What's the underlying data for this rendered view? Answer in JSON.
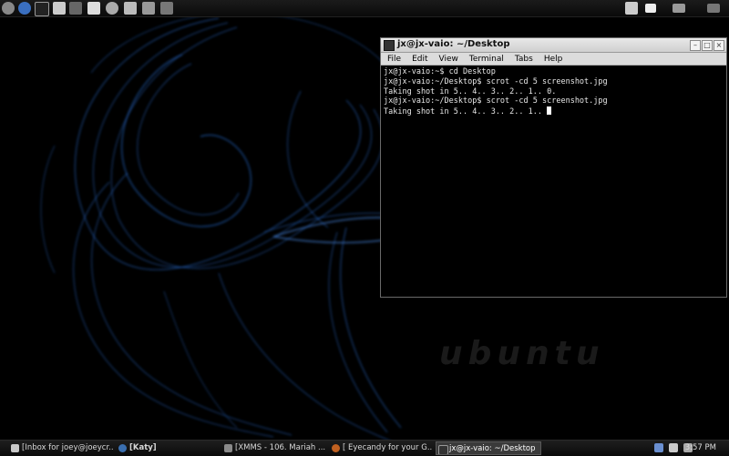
{
  "wallpaper": {
    "brand_text": "ubuntu"
  },
  "top_panel": {
    "icons": [
      "app-menu-icon",
      "globe-icon",
      "terminal-icon",
      "kmail-icon",
      "media-icon",
      "bird-icon",
      "disc-icon",
      "palette-icon",
      "mixer-icon",
      "bluetooth-star-icon"
    ],
    "right_icons": [
      "trash-icon",
      "window-icon",
      "window-icon-2",
      "desktop-icon"
    ]
  },
  "terminal": {
    "title": "jx@jx-vaio: ~/Desktop",
    "menu": [
      "File",
      "Edit",
      "View",
      "Terminal",
      "Tabs",
      "Help"
    ],
    "lines": [
      "jx@jx-vaio:~$ cd Desktop",
      "jx@jx-vaio:~/Desktop$ scrot -cd 5 screenshot.jpg",
      "Taking shot in 5.. 4.. 3.. 2.. 1.. 0.",
      "jx@jx-vaio:~/Desktop$ scrot -cd 5 screenshot.jpg",
      "Taking shot in 5.. 4.. 3.. 2.. 1.. "
    ]
  },
  "taskbar": {
    "tasks": [
      {
        "label": "[Inbox for joey@joeycr...",
        "icon_color": "#c8c8c8",
        "active": false
      },
      {
        "label": "[Katy]",
        "icon_color": "#3a6fb0",
        "active": false
      },
      {
        "label": "[XMMS - 106. Mariah ...",
        "icon_color": "#8a8a8a",
        "active": false
      },
      {
        "label": "[ Eyecandy for your G...",
        "icon_color": "#c06020",
        "active": false
      },
      {
        "label": "jx@jx-vaio: ~/Desktop",
        "icon_color": "#333333",
        "active": true
      }
    ],
    "clock": "3:57 PM"
  },
  "colors": {
    "accent_blue": "#2a6fd6"
  }
}
